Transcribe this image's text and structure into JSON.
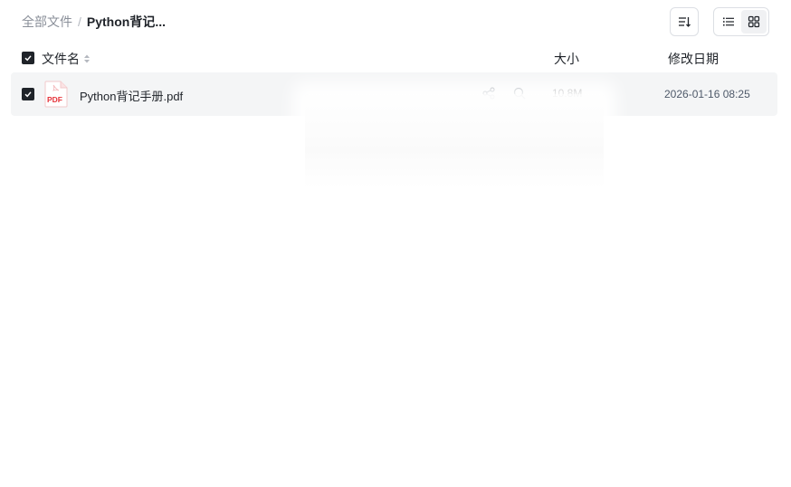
{
  "breadcrumb": {
    "root": "全部文件",
    "separator": "/",
    "current": "Python背记..."
  },
  "toolbar": {
    "sort_icon": "sort-icon",
    "list_view_icon": "list-view-icon",
    "grid_view_icon": "grid-view-icon"
  },
  "table": {
    "columns": {
      "name": "文件名",
      "size": "大小",
      "date": "修改日期"
    },
    "rows": [
      {
        "name": "Python背记手册.pdf",
        "size": "10.8M",
        "date": "2026-01-16 08:25",
        "icon": "pdf-file-icon",
        "icon_label": "PDF",
        "selected": true
      }
    ]
  },
  "colors": {
    "row_bg": "#f4f5f6",
    "checkbox": "#1f2329",
    "pdf_red": "#e6333a"
  }
}
